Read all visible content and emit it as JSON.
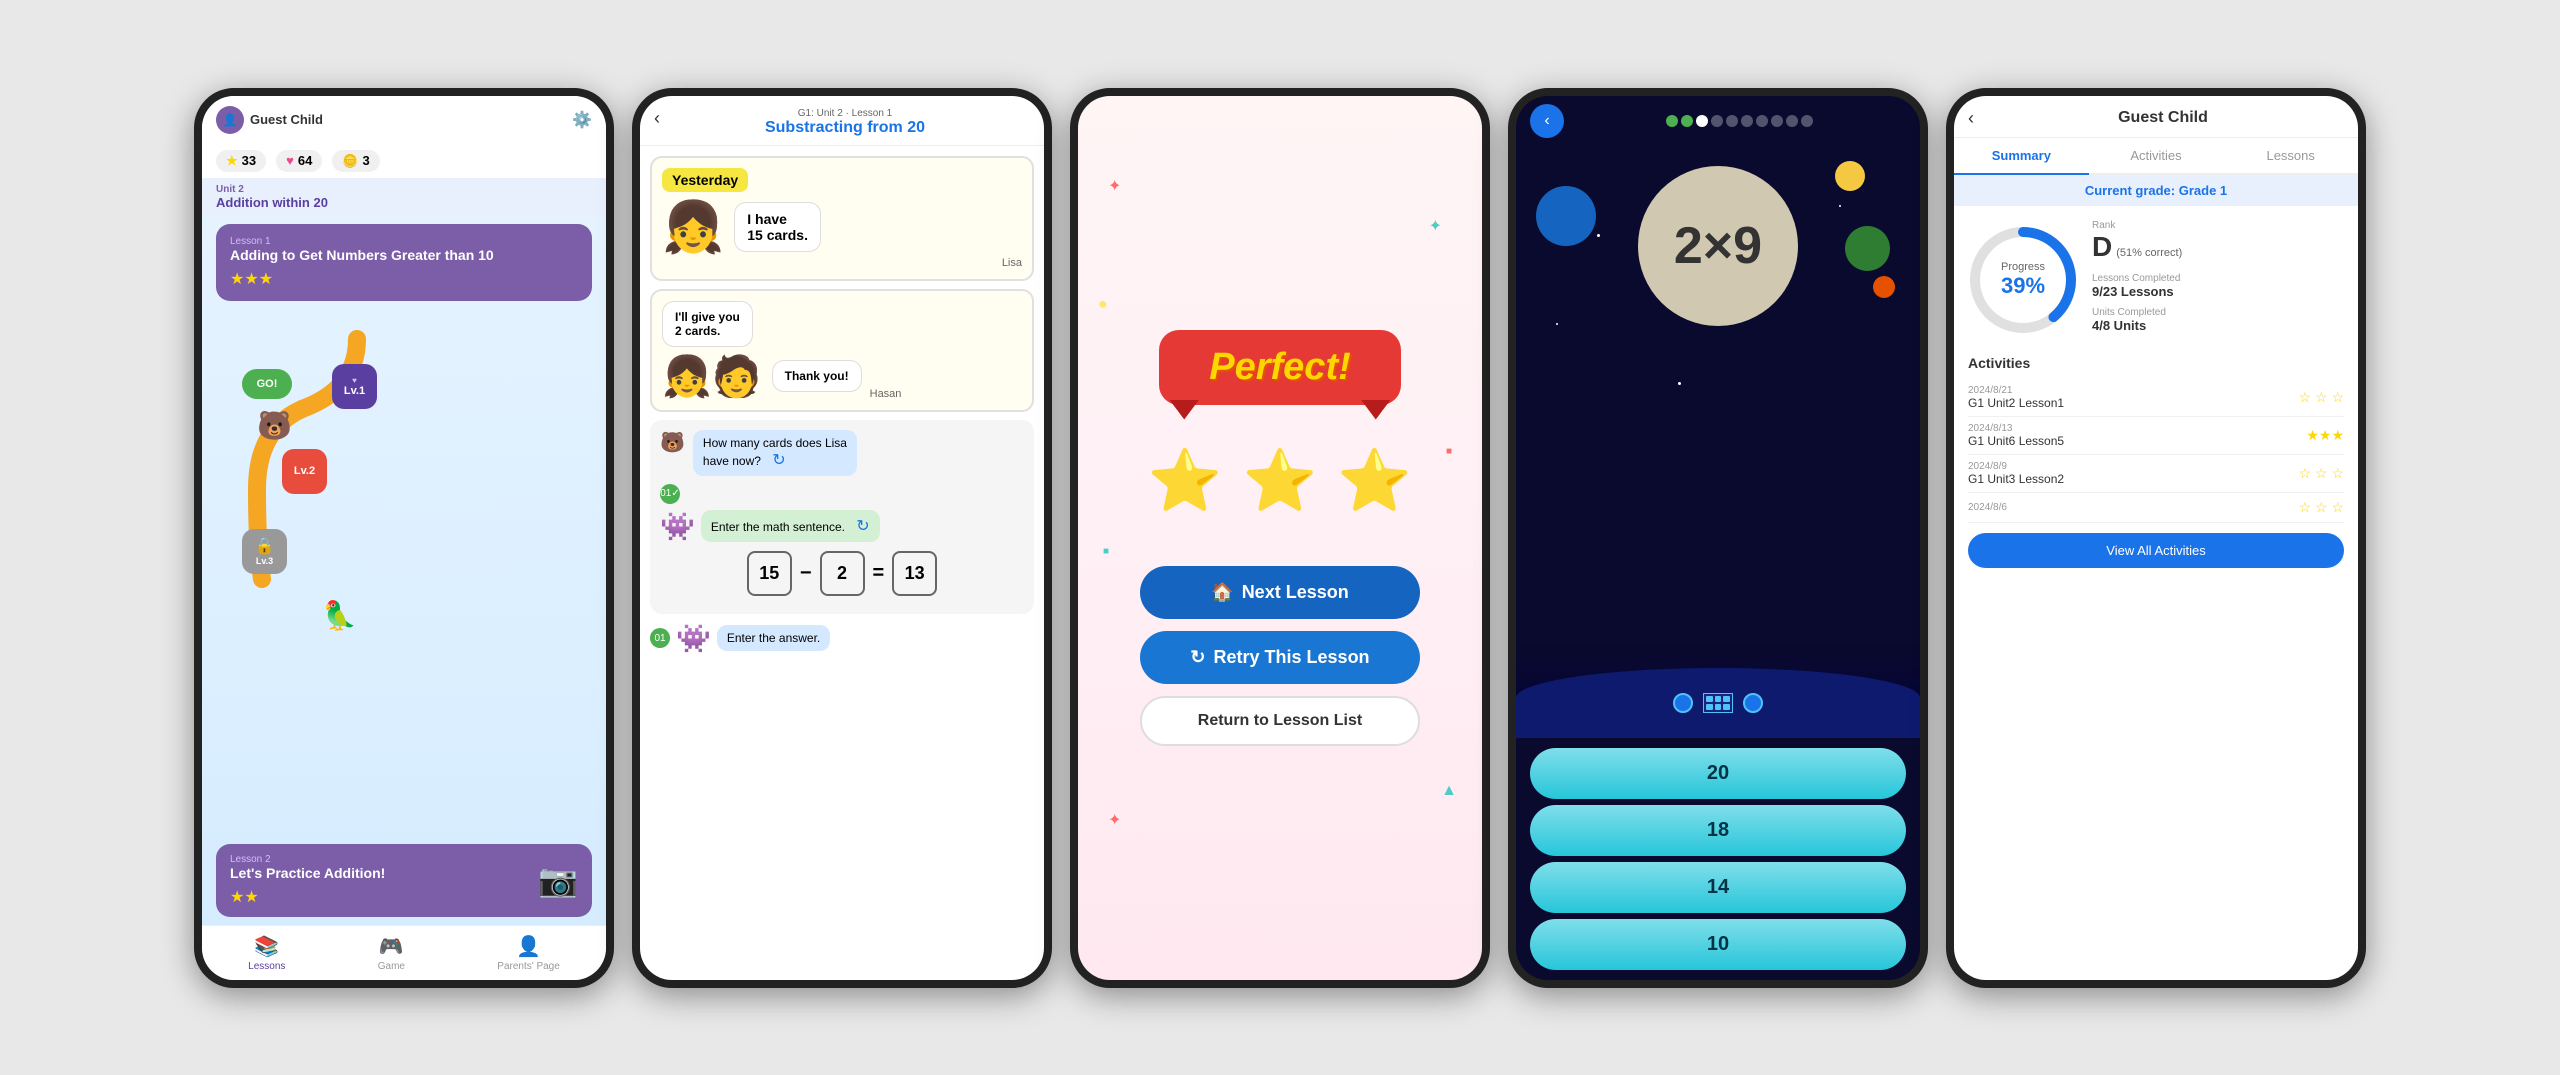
{
  "phone1": {
    "user": {
      "name": "Guest Child",
      "avatar_icon": "person-icon"
    },
    "stats": {
      "stars": "33",
      "hearts": "64",
      "coins": "3"
    },
    "unit": {
      "label": "Unit 2",
      "title": "Addition within 20"
    },
    "lesson1": {
      "label": "Lesson 1",
      "title": "Adding to Get Numbers Greater than 10",
      "stars": "★★★"
    },
    "lesson2": {
      "label": "Lesson 2",
      "title": "Let's Practice Addition!",
      "stars": "★★"
    },
    "map": {
      "go_label": "GO!",
      "lv1_label": "Lv.1",
      "lv2_label": "Lv.2",
      "lv3_label": "Lv.3"
    },
    "nav": {
      "lessons_label": "Lessons",
      "game_label": "Game",
      "parents_label": "Parents' Page"
    }
  },
  "phone2": {
    "header": {
      "subtitle": "G1: Unit 2 · Lesson 1",
      "title": "Substracting from 20",
      "back_icon": "back-arrow-icon"
    },
    "comic1": {
      "day_label": "Yesterday",
      "speech": "I have\n15 cards.",
      "character": "Lisa"
    },
    "comic2": {
      "speech1": "I'll give you\n2 cards.",
      "speech2": "Thank you!",
      "character": "Hasan"
    },
    "chat": {
      "question": "How many cards does Lisa\nhave now?",
      "answer_label": "01",
      "answer_hint": "Enter the math sentence.",
      "equation": {
        "num1": "15",
        "op": "−",
        "num2": "2",
        "eq": "=",
        "result": "13"
      }
    },
    "bottom_label": "01",
    "bottom_hint": "Enter the answer."
  },
  "phone3": {
    "banner_text": "Perfect!",
    "stars": [
      "⭐",
      "⭐",
      "⭐"
    ],
    "btn_next": "Next Lesson",
    "btn_retry": "Retry This Lesson",
    "btn_return": "Return to Lesson List",
    "next_icon": "home-icon",
    "retry_icon": "refresh-icon"
  },
  "phone4": {
    "back_icon": "back-arrow-icon",
    "multiplication": "2×9",
    "answers": [
      "20",
      "18",
      "14",
      "10"
    ],
    "progress_dots": 10
  },
  "phone5": {
    "header": {
      "title": "Guest Child",
      "back_icon": "back-arrow-icon"
    },
    "tabs": [
      "Summary",
      "Activities",
      "Lessons"
    ],
    "active_tab": 0,
    "grade_banner": "Current grade: Grade 1",
    "grade": {
      "letter": "D",
      "sub": "(51% correct)"
    },
    "progress": {
      "label": "Progress",
      "value": "39%",
      "percent": 39
    },
    "lessons_completed": {
      "label": "Lessons Completed",
      "value": "9/23 Lessons"
    },
    "units_completed": {
      "label": "Units Completed",
      "value": "4/8 Units"
    },
    "activities_title": "Activities",
    "activities": [
      {
        "date": "2024/8/21",
        "name": "G1 Unit2 Lesson1",
        "stars": ""
      },
      {
        "date": "2024/8/13",
        "name": "G1 Unit6 Lesson5",
        "stars": "★★★"
      },
      {
        "date": "2024/8/9",
        "name": "G1 Unit3 Lesson2",
        "stars": ""
      },
      {
        "date": "2024/8/6",
        "name": "",
        "stars": ""
      }
    ],
    "view_all_btn": "View All Activities"
  }
}
